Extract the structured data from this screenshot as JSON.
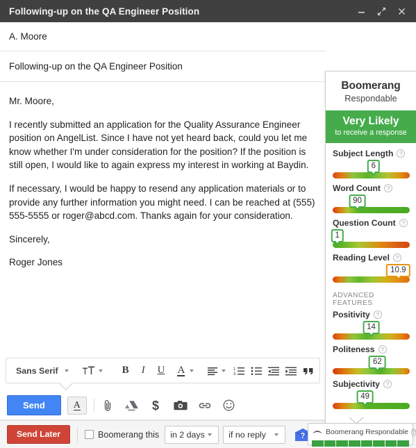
{
  "window": {
    "title": "Following-up on the QA Engineer Position",
    "controls": [
      {
        "name": "minimize-button",
        "icon": "minimize-icon"
      },
      {
        "name": "expand-button",
        "icon": "expand-icon"
      },
      {
        "name": "close-button",
        "icon": "close-icon"
      }
    ]
  },
  "compose": {
    "to_value": "A. Moore",
    "subject_value": "Following-up on the QA Engineer Position",
    "body": [
      "Mr. Moore,",
      "I recently submitted an application for the Quality Assurance Engineer position on AngelList. Since I have not yet heard back, could you let me know whether I'm under consideration for the position? If the position is still open, I would like to again express my interest in working at Baydin.",
      "If necessary, I would be happy to resend any application materials or to provide any further information you might need. I can be reached at (555) 555-5555 or roger@abcd.com. Thanks again for your consideration.",
      "Sincerely,",
      "Roger Jones"
    ]
  },
  "format_toolbar": {
    "font_name": "Sans Serif",
    "items": [
      {
        "name": "font-size-button",
        "icon": "text-size-icon"
      },
      {
        "name": "bold-button",
        "label": "B"
      },
      {
        "name": "italic-button",
        "label": "I"
      },
      {
        "name": "underline-button",
        "label": "U"
      },
      {
        "name": "text-color-button",
        "label": "A"
      },
      {
        "name": "align-button",
        "icon": "align-icon"
      },
      {
        "name": "numbered-list-button",
        "icon": "numbered-list-icon"
      },
      {
        "name": "bulleted-list-button",
        "icon": "bulleted-list-icon"
      },
      {
        "name": "indent-less-button",
        "icon": "indent-decrease-icon"
      },
      {
        "name": "indent-more-button",
        "icon": "indent-increase-icon"
      },
      {
        "name": "quote-button",
        "icon": "quote-icon"
      },
      {
        "name": "remove-formatting-button",
        "icon": "remove-formatting-icon"
      }
    ]
  },
  "send_row": {
    "send_label": "Send",
    "formatting_toggle": "A",
    "icons": [
      {
        "name": "attach-file-icon"
      },
      {
        "name": "google-drive-icon"
      },
      {
        "name": "insert-money-icon"
      },
      {
        "name": "insert-photo-icon"
      },
      {
        "name": "insert-link-icon"
      },
      {
        "name": "insert-emoji-icon"
      }
    ]
  },
  "boomerang_bar": {
    "send_later_label": "Send Later",
    "checkbox_label": "Boomerang this",
    "checkbox_checked": false,
    "when_value": "in 2 days",
    "condition_value": "if no reply",
    "help_icon": "help-envelope-icon"
  },
  "panel": {
    "title": "Boomerang",
    "subtitle": "Respondable",
    "verdict_main": "Very Likely",
    "verdict_sub": "to receive a response",
    "verdict_color": "#45ab4b",
    "advanced_header": "ADVANCED FEATURES",
    "metrics": [
      {
        "label": "Subject Length",
        "value": "6",
        "pos": 53,
        "bubble": "green",
        "gradient": "linear-gradient(to right, #d84a18 0%, #e8760f 11%, #8cc63e 27%, #5eb229 45%, #7cc03a 58%, #b9c22c 72%, #e09010 88%, #db5a14 100%)"
      },
      {
        "label": "Word Count",
        "value": "90",
        "pos": 32,
        "bubble": "green",
        "gradient": "linear-gradient(to right, #d63d17 0%, #e07a10 9%, #a9c832 20%, #55b026 34%, #49ab22 100%)"
      },
      {
        "label": "Question Count",
        "value": "1",
        "pos": 5,
        "bubble": "green",
        "gradient": "linear-gradient(to right, #4cae24 0%, #64b628 14%, #a8c730 34%, #e08a10 62%, #d95c14 85%, #d4470f 100%)"
      },
      {
        "label": "Reading Level",
        "value": "10.9",
        "pos": 85,
        "bubble": "orange",
        "gradient": "linear-gradient(to right, #d8400f 0%, #e07a10 8%, #8cc63e 22%, #63b429 34%, #9bc533 50%, #d9ad14 70%, #e08c10 86%, #dd6f12 100%)"
      }
    ],
    "advanced_metrics": [
      {
        "label": "Positivity",
        "value": "14",
        "pos": 50,
        "bubble": "green",
        "gradient": "linear-gradient(to right, #d8450f 0%, #e08010 12%, #8fc63c 28%, #5bb127 44%, #8bc339 58%, #cbb520 74%, #e08910 88%, #d85414 100%)"
      },
      {
        "label": "Politeness",
        "value": "62",
        "pos": 58,
        "bubble": "green",
        "gradient": "linear-gradient(to right, #d6380f 0%, #de7410 14%, #c5be26 32%, #8cc63e 46%, #55b026 62%, #8dc438 78%, #d89b14 92%, #dd6b12 100%)"
      },
      {
        "label": "Subjectivity",
        "value": "49",
        "pos": 42,
        "bubble": "green",
        "gradient": "linear-gradient(to right, #d8400f 0%, #e08510 14%, #a6c632 28%, #57b026 44%, #49ab22 100%)"
      }
    ]
  },
  "respondable_widget": {
    "label": "Boomerang Respondable",
    "collapse_icon": "chevron-up-icon",
    "help_icon": "help-icon",
    "segments": 8,
    "segment_color": "#3aa13f"
  }
}
